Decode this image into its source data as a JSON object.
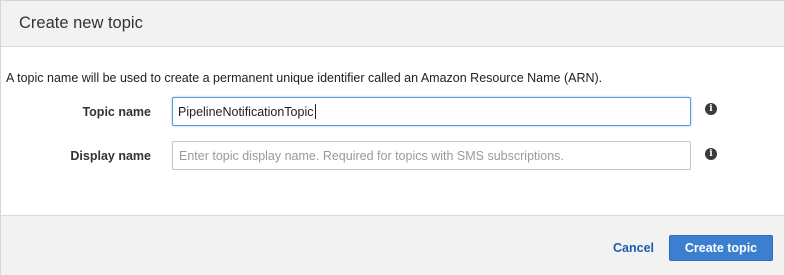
{
  "dialog": {
    "title": "Create new topic",
    "intro": "A topic name will be used to create a permanent unique identifier called an Amazon Resource Name (ARN).",
    "fields": {
      "topic_name": {
        "label": "Topic name",
        "value": "PipelineNotificationTopic",
        "icon": "info-icon"
      },
      "display_name": {
        "label": "Display name",
        "value": "",
        "placeholder": "Enter topic display name. Required for topics with SMS subscriptions.",
        "icon": "info-icon"
      }
    },
    "footer": {
      "cancel_label": "Cancel",
      "create_label": "Create topic"
    },
    "colors": {
      "primary_button": "#3b7fd1",
      "link": "#1a5ea8",
      "focus_border": "#5b9bd5"
    }
  }
}
